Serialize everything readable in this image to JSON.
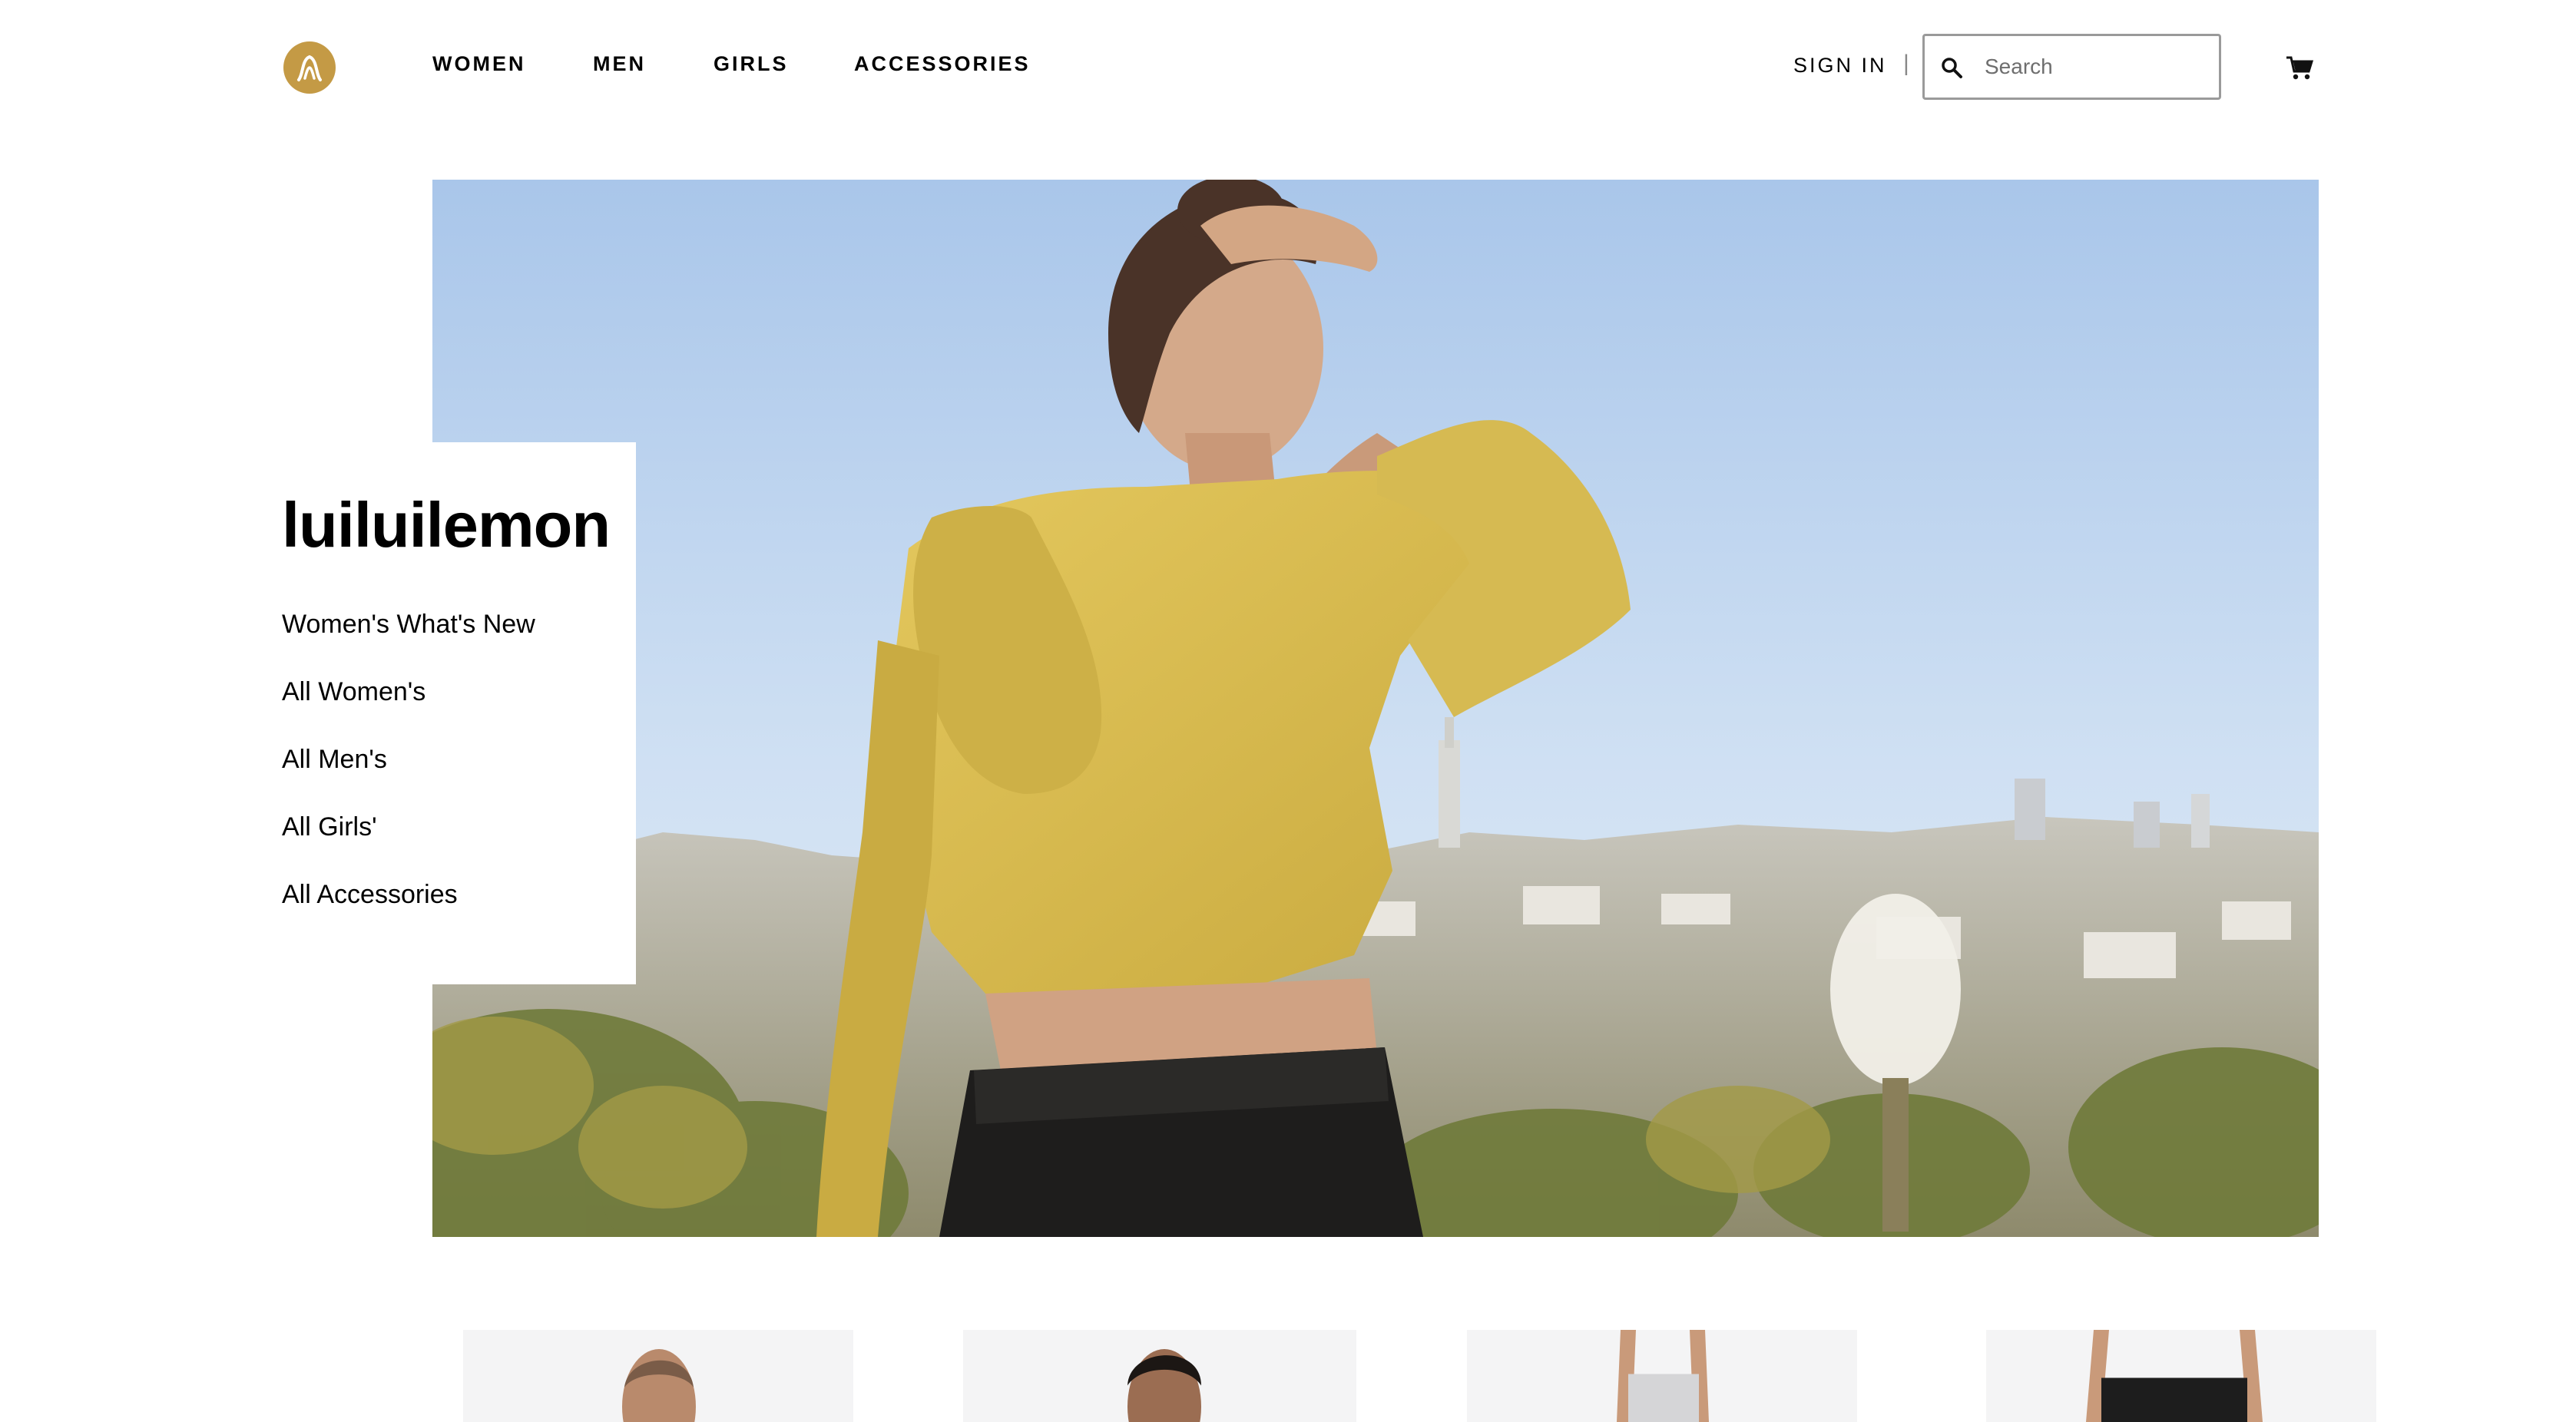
{
  "header": {
    "logo_icon": "lululemon-logo-icon",
    "nav": [
      "WOMEN",
      "MEN",
      "GIRLS",
      "ACCESSORIES"
    ],
    "sign_in": "SIGN IN",
    "divider": "|",
    "search_placeholder": "Search",
    "search_icon": "search-icon",
    "cart_icon": "cart-icon"
  },
  "sidebar_menu": {
    "title": "luiluilemon",
    "links": [
      "Women's What's New",
      "All Women's",
      "All Men's",
      "All Girls'",
      "All Accessories"
    ]
  },
  "hero": {
    "image": "woman-in-yellow-cropped-hoodie-over-city-skyline"
  },
  "products": [
    {
      "image": "man-headshot"
    },
    {
      "image": "man-headshot"
    },
    {
      "image": "grey-shorts"
    },
    {
      "image": "black-shorts"
    }
  ],
  "colors": {
    "brand": "#c49a45",
    "hoodie": "#d9bd4f",
    "sky": "#b9d3ef"
  }
}
